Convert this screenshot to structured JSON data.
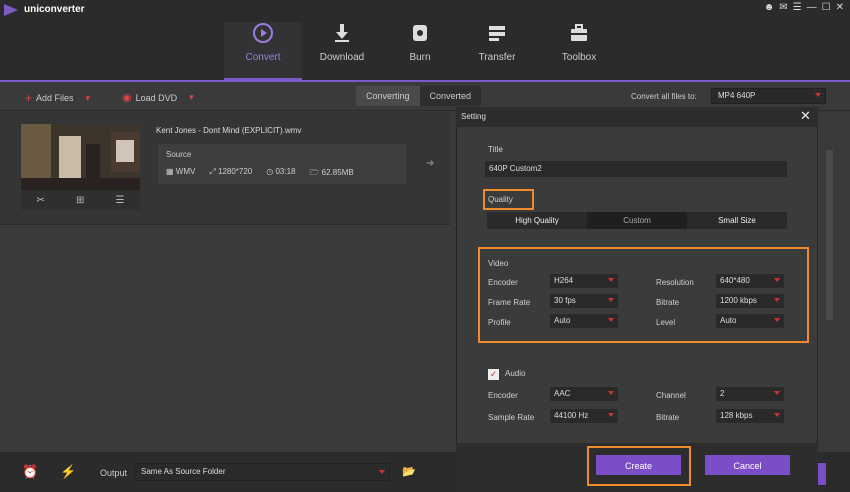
{
  "app": {
    "name": "uniconverter",
    "logo_icon": "play-triangle-icon",
    "accent": "#7b5cc4"
  },
  "window_controls": [
    "user-icon",
    "chat-icon",
    "menu-icon",
    "minimize-icon",
    "maximize-icon",
    "close-icon"
  ],
  "nav": {
    "tabs": [
      {
        "label": "Convert",
        "icon": "convert-icon",
        "active": true
      },
      {
        "label": "Download",
        "icon": "download-icon"
      },
      {
        "label": "Burn",
        "icon": "burn-icon"
      },
      {
        "label": "Transfer",
        "icon": "transfer-icon"
      },
      {
        "label": "Toolbox",
        "icon": "toolbox-icon"
      }
    ]
  },
  "toolbar": {
    "add_files": "Add Files",
    "load_dvd": "Load DVD",
    "converting": "Converting",
    "converted": "Converted",
    "convert_all_label": "Convert all files to:",
    "convert_all_value": "MP4 640P"
  },
  "file": {
    "name": "Kent Jones - Dont Mind (EXPLICIT).wmv",
    "source_label": "Source",
    "format": "WMV",
    "resolution": "1280*720",
    "duration": "03:18",
    "size": "62.85MB"
  },
  "dialog": {
    "title": "Setting",
    "name_label": "Title",
    "name_value": "640P Custom2",
    "quality_label": "Quality",
    "quality_options": [
      "High Quality",
      "Custom",
      "Small Size"
    ],
    "quality_selected": "Custom",
    "video": {
      "heading": "Video",
      "encoder_label": "Encoder",
      "encoder": "H264",
      "frame_rate_label": "Frame Rate",
      "frame_rate": "30 fps",
      "profile_label": "Profile",
      "profile": "Auto",
      "resolution_label": "Resolution",
      "resolution": "640*480",
      "bitrate_label": "Bitrate",
      "bitrate": "1200 kbps",
      "level_label": "Level",
      "level": "Auto"
    },
    "audio": {
      "heading": "Audio",
      "checked": true,
      "encoder_label": "Encoder",
      "encoder": "AAC",
      "sample_rate_label": "Sample Rate",
      "sample_rate": "44100 Hz",
      "channel_label": "Channel",
      "channel": "2",
      "bitrate_label": "Bitrate",
      "bitrate": "128 kbps"
    },
    "create": "Create",
    "cancel": "Cancel"
  },
  "bottom": {
    "output_label": "Output",
    "output_value": "Same As Source Folder"
  }
}
